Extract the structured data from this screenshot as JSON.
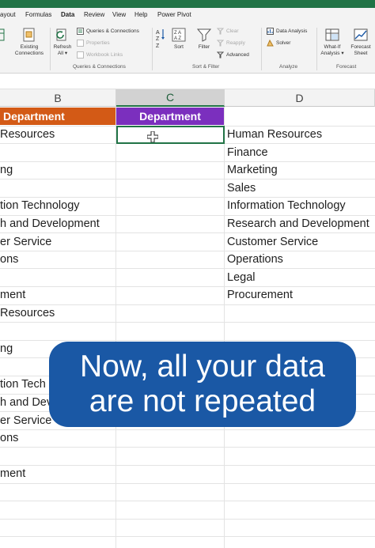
{
  "ribbon_tabs": [
    "ayout",
    "Formulas",
    "Data",
    "Review",
    "View",
    "Help",
    "Power Pivot"
  ],
  "active_tab": "Data",
  "ribbon": {
    "existing_connections": [
      "Existing",
      "Connections"
    ],
    "refresh_all": [
      "Refresh",
      "All"
    ],
    "queries_connections": "Queries & Connections",
    "properties": "Properties",
    "workbook_links": "Workbook Links",
    "group_queries": "Queries & Connections",
    "sort": "Sort",
    "filter": "Filter",
    "clear": "Clear",
    "reapply": "Reapply",
    "advanced": "Advanced",
    "group_sort_filter": "Sort & Filter",
    "data_analysis": "Data Analysis",
    "solver": "Solver",
    "group_analyze": "Analyze",
    "whatif": [
      "What-If",
      "Analysis"
    ],
    "forecast_sheet": [
      "Forecast",
      "Sheet"
    ],
    "group_forecast": "Forecast",
    "accent": "#217346"
  },
  "columns": [
    "B",
    "C",
    "D"
  ],
  "selected_column": "C",
  "header_b": "Department",
  "header_c": "Department",
  "header_b_color": "#d35a16",
  "header_c_color": "#7b2fbe",
  "column_b": [
    "Resources",
    "",
    "ng",
    "",
    "tion Technology",
    "h and Development",
    "er Service",
    "ons",
    "",
    "ment",
    "Resources",
    "",
    "ng",
    "",
    "tion Tech",
    "h and Dev",
    "er Service",
    "ons",
    "",
    "ment"
  ],
  "column_d": [
    "Human Resources",
    "Finance",
    "Marketing",
    "Sales",
    "Information Technology",
    "Research and Development",
    "Customer Service",
    "Operations",
    "Legal",
    "Procurement"
  ],
  "caption": {
    "line1": "Now, all your data",
    "line2": "are not repeated",
    "bg": "#1a58a5"
  }
}
